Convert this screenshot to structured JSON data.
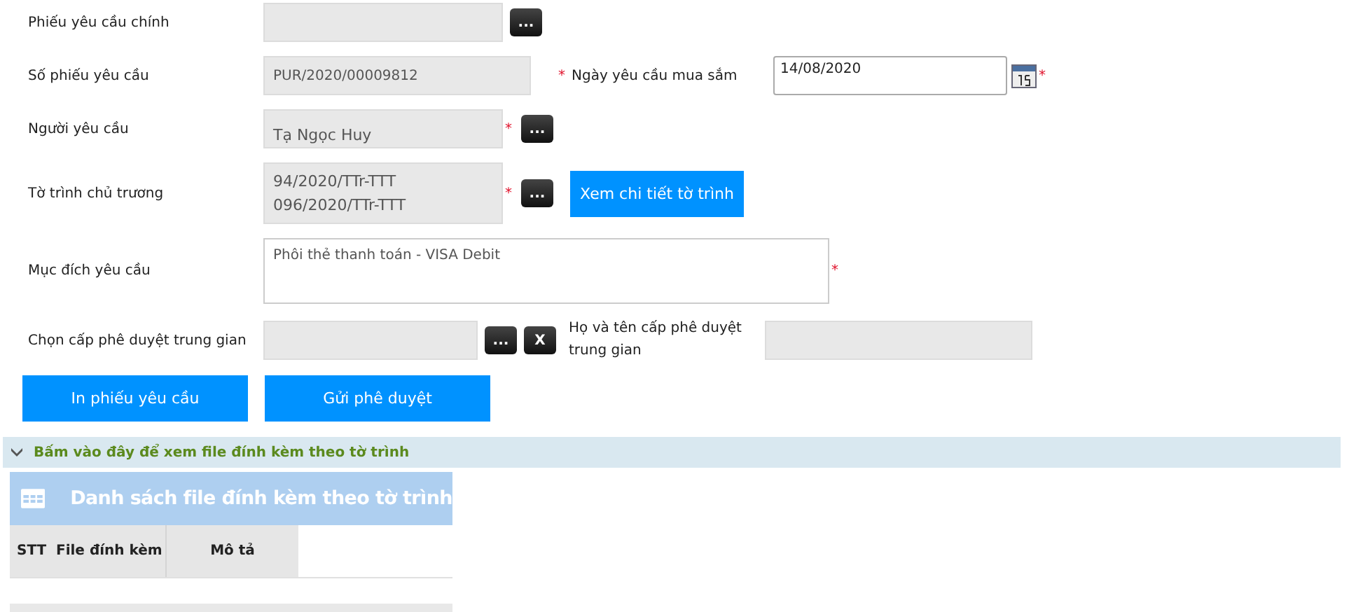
{
  "form": {
    "main_request": {
      "label": "Phiếu yêu cầu chính",
      "lookup_button": "..."
    },
    "request_number": {
      "label": "Số phiếu yêu cầu",
      "value": "PUR/2020/00009812"
    },
    "purchase_date": {
      "mark": "*",
      "label": "Ngày yêu cầu mua sắm",
      "value": "14/08/2020",
      "mark_after": "*"
    },
    "requester": {
      "label": "Người yêu cầu",
      "value": "Tạ Ngọc Huy",
      "mark": "*",
      "lookup_button": "..."
    },
    "proposal": {
      "label": "Tờ trình chủ trương",
      "values": [
        "94/2020/TTr-TTT",
        "096/2020/TTr-TTT"
      ],
      "mark": "*",
      "lookup_button": "...",
      "detail_button": "Xem chi tiết tờ trình"
    },
    "purpose": {
      "label": "Mục đích yêu cầu",
      "value": "Phôi thẻ thanh toán - VISA Debit",
      "mark": "*"
    },
    "approver": {
      "label": "Chọn cấp phê duyệt trung gian",
      "lookup_button": "...",
      "clear_button": "X",
      "name_label": "Họ và tên cấp phê duyệt trung gian"
    }
  },
  "actions": [
    "In phiếu yêu cầu",
    "Gửi phê duyệt"
  ],
  "attachments": {
    "toggle": "Bấm vào đây để xem file đính kèm theo tờ trình",
    "expanded": true,
    "title": "Danh sách file đính kèm theo tờ trình",
    "columns": [
      "STT",
      "File đính kèm",
      "Mô tả"
    ]
  }
}
